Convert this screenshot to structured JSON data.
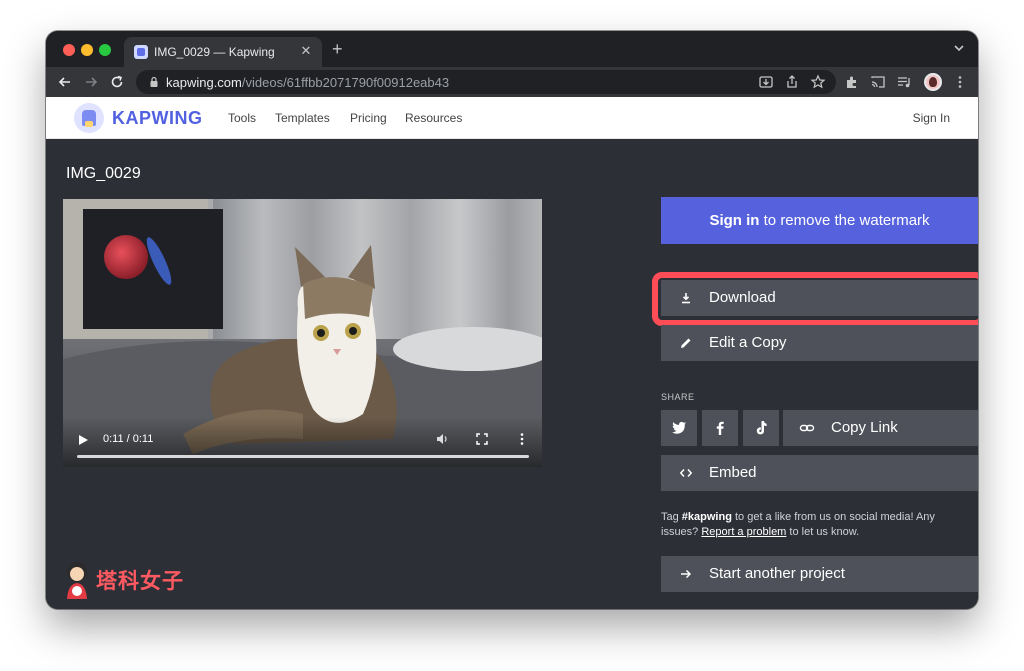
{
  "browser": {
    "tab_title": "IMG_0029 — Kapwing",
    "tab_close": "✕",
    "new_tab": "+",
    "url_host": "kapwing.com",
    "url_path": "/videos/61ffbb2071790f00912eab43"
  },
  "site_nav": {
    "logo": "KAPWING",
    "links": [
      "Tools",
      "Templates",
      "Pricing",
      "Resources"
    ],
    "sign_in": "Sign In"
  },
  "video": {
    "title": "IMG_0029",
    "time": "0:11 / 0:11",
    "progress": 1.0
  },
  "actions": {
    "signin_bold": "Sign in",
    "signin_rest": " to remove the watermark",
    "download": "Download",
    "edit_copy": "Edit a Copy",
    "share_label": "SHARE",
    "copy_link": "Copy Link",
    "embed": "Embed",
    "start_project": "Start another project"
  },
  "info": {
    "prefix": "Tag ",
    "hashtag": "#kapwing",
    "middle": " to get a like from us on social media! Any issues? ",
    "link": "Report a problem",
    "suffix": " to let us know."
  },
  "watermark": {
    "text": "塔科女子"
  },
  "colors": {
    "accent": "#5662dd",
    "highlight": "#ff4d57",
    "button": "#4e5159",
    "background": "#2c2f36"
  }
}
